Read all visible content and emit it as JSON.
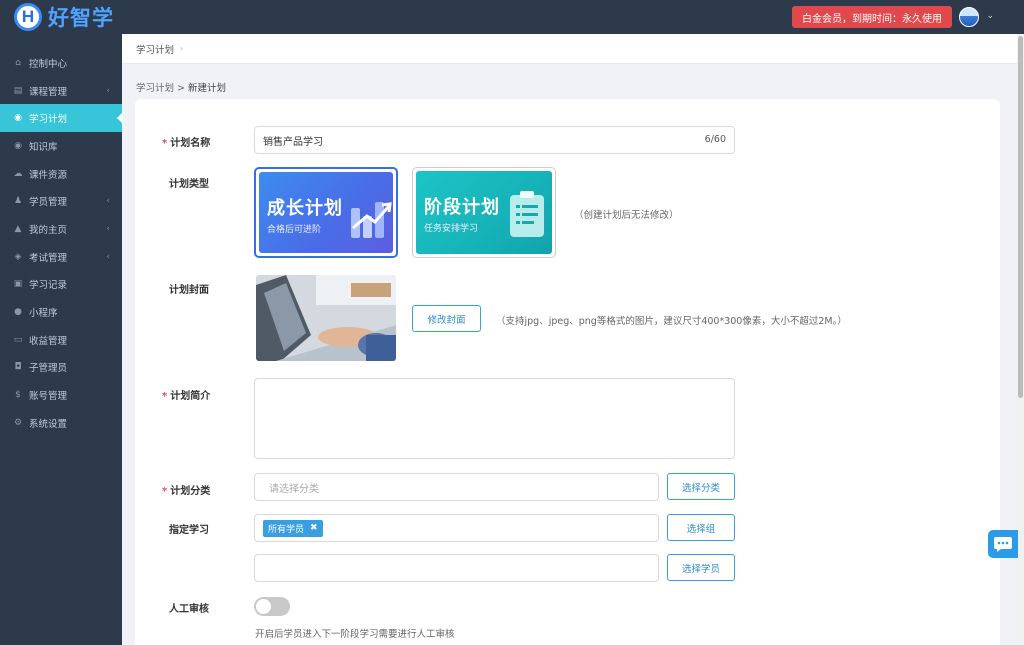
{
  "app": {
    "logo_letter": "H",
    "logo_text": "好智学"
  },
  "header": {
    "vip_text": "白金会员，到期时间：永久使用",
    "caret": "⌄"
  },
  "sidebar": {
    "items": [
      {
        "label": "控制中心",
        "icon": "home-icon",
        "glyph": "⌂",
        "caret": ""
      },
      {
        "label": "课程管理",
        "icon": "book-icon",
        "glyph": "▤",
        "caret": "‹"
      },
      {
        "label": "学习计划",
        "icon": "eye-icon",
        "glyph": "◉",
        "caret": ""
      },
      {
        "label": "知识库",
        "icon": "eye-icon",
        "glyph": "◉",
        "caret": ""
      },
      {
        "label": "课件资源",
        "icon": "cloud-icon",
        "glyph": "☁",
        "caret": ""
      },
      {
        "label": "学员管理",
        "icon": "users-icon",
        "glyph": "♟",
        "caret": "‹"
      },
      {
        "label": "我的主页",
        "icon": "graduation-cap-icon",
        "glyph": "▲",
        "caret": "‹"
      },
      {
        "label": "考试管理",
        "icon": "tag-icon",
        "glyph": "◈",
        "caret": "‹"
      },
      {
        "label": "学习记录",
        "icon": "chat-icon",
        "glyph": "▣",
        "caret": ""
      },
      {
        "label": "小程序",
        "icon": "wechat-icon",
        "glyph": "●",
        "caret": ""
      },
      {
        "label": "收益管理",
        "icon": "card-icon",
        "glyph": "▭",
        "caret": ""
      },
      {
        "label": "子管理员",
        "icon": "lock-icon",
        "glyph": "◘",
        "caret": ""
      },
      {
        "label": "账号管理",
        "icon": "dollar-icon",
        "glyph": "$",
        "caret": ""
      },
      {
        "label": "系统设置",
        "icon": "gear-icon",
        "glyph": "⚙",
        "caret": ""
      }
    ],
    "active_index": 2
  },
  "breadcrumb": {
    "top": "学习计划",
    "top_sep": "›",
    "parent": "学习计划",
    "sep": " > ",
    "current": "新建计划"
  },
  "form": {
    "name": {
      "label": "计划名称",
      "required": "*",
      "value": "销售产品学习",
      "counter": "6/60"
    },
    "type": {
      "label": "计划类型",
      "options": [
        {
          "title": "成长计划",
          "subtitle": "合格后可进阶"
        },
        {
          "title": "阶段计划",
          "subtitle": "任务安排学习"
        }
      ],
      "note": "（创建计划后无法修改）"
    },
    "cover": {
      "label": "计划封面",
      "button": "修改封面",
      "note": "（支持jpg、jpeg、png等格式的图片，建议尺寸400*300像素，大小不超过2M。）"
    },
    "intro": {
      "label": "计划简介",
      "required": "*",
      "value": ""
    },
    "category": {
      "label": "计划分类",
      "required": "*",
      "placeholder": "请选择分类",
      "button": "选择分类"
    },
    "assign": {
      "label": "指定学习",
      "tag": "所有学员",
      "tag_close": "✖",
      "button_group": "选择组",
      "button_student": "选择学员"
    },
    "review": {
      "label": "人工审核",
      "enabled": false,
      "hint": "开启后学员进入下一阶段学习需要进行人工审核"
    }
  },
  "colors": {
    "sidebar_bg": "#2d3a4b",
    "active": "#39c5d9",
    "primary": "#3470e4",
    "vip": "#e0484b"
  }
}
